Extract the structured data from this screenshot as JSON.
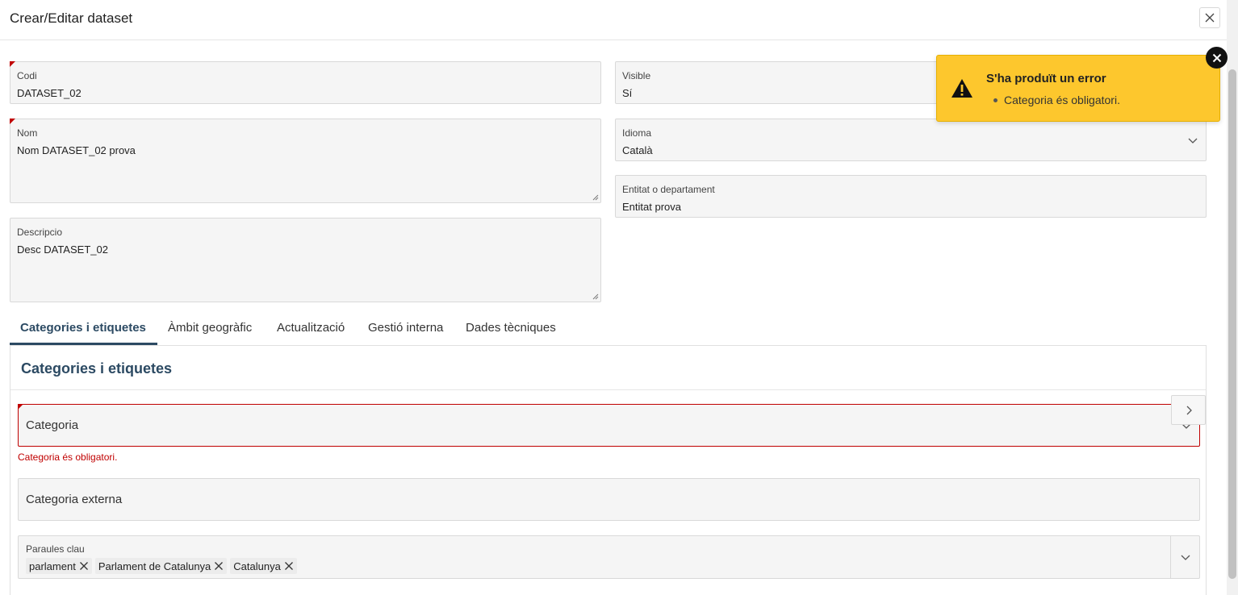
{
  "dialog": {
    "title": "Crear/Editar dataset"
  },
  "fields": {
    "codi": {
      "label": "Codi",
      "value": "DATASET_02"
    },
    "nom": {
      "label": "Nom",
      "value": "Nom DATASET_02 prova"
    },
    "descripcio": {
      "label": "Descripcio",
      "value": "Desc DATASET_02"
    },
    "visible": {
      "label": "Visible",
      "value": "Sí"
    },
    "idioma": {
      "label": "Idioma",
      "value": "Català"
    },
    "entitat": {
      "label": "Entitat o departament",
      "value": "Entitat prova"
    }
  },
  "tabs": [
    {
      "label": "Categories i etiquetes"
    },
    {
      "label": "Àmbit geogràfic"
    },
    {
      "label": "Actualització"
    },
    {
      "label": "Gestió interna"
    },
    {
      "label": "Dades tècniques"
    }
  ],
  "panel": {
    "heading": "Categories i etiquetes",
    "categoria": {
      "placeholder": "Categoria",
      "error": "Categoria és obligatori."
    },
    "categoria_externa": {
      "placeholder": "Categoria externa"
    },
    "paraules_clau": {
      "label": "Paraules clau",
      "tags": [
        "parlament",
        "Parlament de Catalunya",
        "Catalunya"
      ]
    }
  },
  "toast": {
    "title": "S'ha produït un error",
    "message": "Categoria és obligatori.",
    "color": "#fdc72d"
  },
  "colors": {
    "accent": "#2c4a63",
    "error": "#c00000"
  }
}
